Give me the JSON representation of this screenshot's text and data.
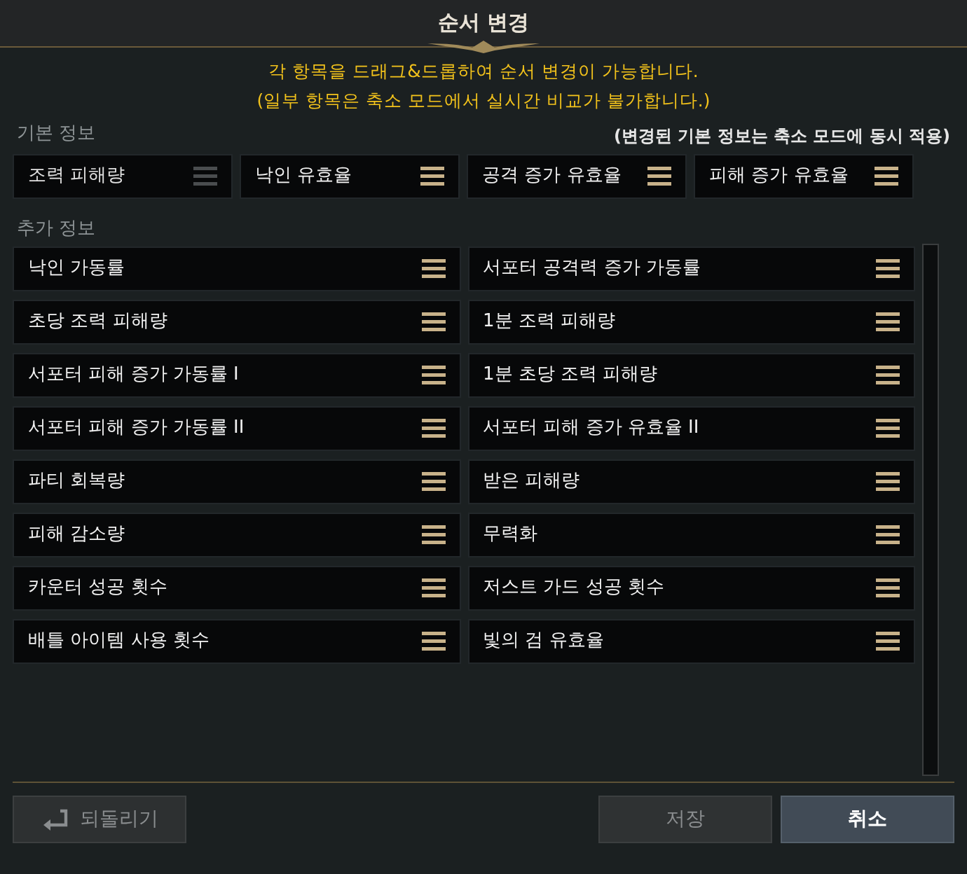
{
  "window": {
    "title": "순서 변경"
  },
  "notice": [
    "각 항목을 드래그&드롭하여 순서 변경이 가능합니다.",
    "(일부 항목은 축소 모드에서 실시간 비교가 불가합니다.)"
  ],
  "basic": {
    "label": "기본 정보",
    "note": "(변경된 기본 정보는 축소 모드에 동시 적용)",
    "items": [
      {
        "label": "조력 피해량",
        "disabled": true
      },
      {
        "label": "낙인 유효율",
        "disabled": false
      },
      {
        "label": "공격 증가 유효율",
        "disabled": false
      },
      {
        "label": "피해 증가 유효율",
        "disabled": false
      }
    ]
  },
  "extra": {
    "label": "추가 정보",
    "items": [
      {
        "label": "낙인 가동률",
        "disabled": false
      },
      {
        "label": "서포터 공격력 증가 가동률",
        "disabled": false
      },
      {
        "label": "초당 조력 피해량",
        "disabled": false
      },
      {
        "label": "1분 조력 피해량",
        "disabled": false
      },
      {
        "label": "서포터 피해 증가 가동률 I",
        "disabled": false
      },
      {
        "label": "1분 초당 조력 피해량",
        "disabled": false
      },
      {
        "label": "서포터 피해 증가 가동률 II",
        "disabled": false
      },
      {
        "label": "서포터 피해 증가 유효율 II",
        "disabled": false
      },
      {
        "label": "파티 회복량",
        "disabled": false
      },
      {
        "label": "받은 피해량",
        "disabled": false
      },
      {
        "label": "피해 감소량",
        "disabled": false
      },
      {
        "label": "무력화",
        "disabled": false
      },
      {
        "label": "카운터 성공 횟수",
        "disabled": false
      },
      {
        "label": "저스트 가드 성공 횟수",
        "disabled": false
      },
      {
        "label": "배틀 아이템 사용 횟수",
        "disabled": false
      },
      {
        "label": "빛의 검 유효율",
        "disabled": false
      }
    ]
  },
  "buttons": [
    {
      "kind": "revert",
      "label": "되돌리기",
      "disabled": true
    },
    {
      "kind": "save",
      "label": "저장",
      "disabled": true
    },
    {
      "kind": "cancel",
      "label": "취소",
      "disabled": false
    }
  ]
}
